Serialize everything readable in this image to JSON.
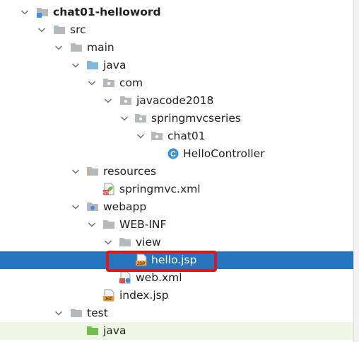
{
  "tree": [
    {
      "label": "chat01-helloword",
      "icon": "module-folder-icon",
      "bold": true
    },
    {
      "label": "src",
      "icon": "folder-icon"
    },
    {
      "label": "main",
      "icon": "folder-icon"
    },
    {
      "label": "java",
      "icon": "source-root-folder-icon"
    },
    {
      "label": "com",
      "icon": "package-icon"
    },
    {
      "label": "javacode2018",
      "icon": "package-icon"
    },
    {
      "label": "springmvcseries",
      "icon": "package-icon"
    },
    {
      "label": "chat01",
      "icon": "package-icon"
    },
    {
      "label": "HelloController",
      "icon": "java-class-icon"
    },
    {
      "label": "resources",
      "icon": "resources-folder-icon"
    },
    {
      "label": "springmvc.xml",
      "icon": "spring-xml-file-icon"
    },
    {
      "label": "webapp",
      "icon": "web-folder-icon"
    },
    {
      "label": "WEB-INF",
      "icon": "folder-icon"
    },
    {
      "label": "view",
      "icon": "folder-icon"
    },
    {
      "label": "hello.jsp",
      "icon": "jsp-file-icon",
      "selected": true
    },
    {
      "label": "web.xml",
      "icon": "web-xml-file-icon"
    },
    {
      "label": "index.jsp",
      "icon": "jsp-file-icon"
    },
    {
      "label": "test",
      "icon": "folder-icon"
    },
    {
      "label": "java",
      "icon": "test-source-folder-icon"
    }
  ],
  "icon_text": {
    "jsp": "JSP",
    "class": "C"
  },
  "colors": {
    "selection": "#2675bf",
    "highlight_box": "#e01515",
    "folder": "#b4b9be",
    "source_folder": "#7eb8dd",
    "test_folder": "#6fbf4a",
    "class_icon": "#3d8fd6",
    "jsp_icon": "#e8a33b"
  }
}
